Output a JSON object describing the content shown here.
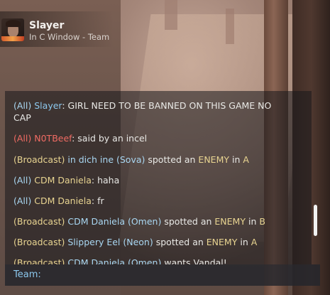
{
  "player": {
    "name": "Slayer",
    "status": "In C Window - Team"
  },
  "chat": {
    "messages": [
      {
        "channel": "(All)",
        "sender": "Slayer",
        "text": "GIRL NEED TO BE BANNED ON THIS GAME NO",
        "text_line2": "CAP"
      },
      {
        "channel": "(All)",
        "sender": "N0TBeef",
        "text": "said by an incel"
      },
      {
        "channel": "(Broadcast)",
        "sender": "in dich ine (Sova)",
        "text": "spotted an",
        "highlight": "ENEMY",
        "text_after": "in",
        "site": "A"
      },
      {
        "channel": "(All)",
        "sender": "CDM Daniela",
        "text": "haha"
      },
      {
        "channel": "(All)",
        "sender": "CDM Daniela",
        "text": "fr"
      },
      {
        "channel": "(Broadcast)",
        "sender": "CDM Daniela (Omen)",
        "text": "spotted an",
        "highlight": "ENEMY",
        "text_after": "in",
        "site": "B"
      },
      {
        "channel": "(Broadcast)",
        "sender": "Slippery Eel (Neon)",
        "text": "spotted an",
        "highlight": "ENEMY",
        "text_after": "in",
        "site": "A"
      },
      {
        "channel": "(Broadcast)",
        "sender": "CDM Daniela (Omen)",
        "text": "wants Vandal!"
      }
    ]
  },
  "input": {
    "label": "Team:",
    "value": ""
  },
  "colors": {
    "all_label": "#a9d7f2",
    "enemy_team": "#f06b63",
    "broadcast": "#e8d491",
    "ally_name": "#8cc8ee"
  }
}
